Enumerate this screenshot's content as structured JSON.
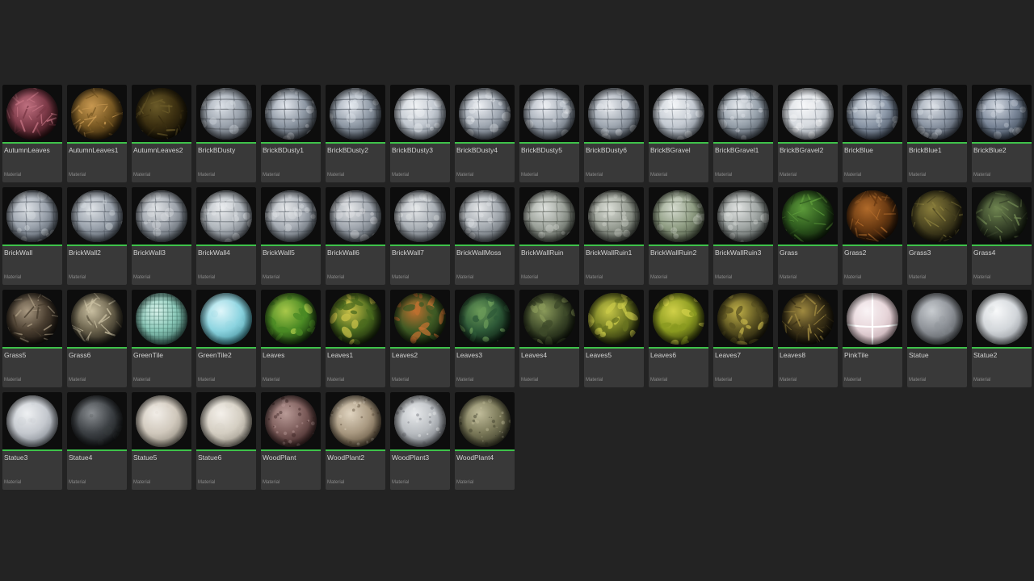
{
  "asset_type_label": "Material",
  "accent_color": "#3ec24a",
  "assets": [
    {
      "name": "AutumnLeaves",
      "base": "#2a0f12",
      "mid": "#7a3846",
      "hi": "#c07080",
      "pattern": "fibers"
    },
    {
      "name": "AutumnLeaves1",
      "base": "#2b1e08",
      "mid": "#7a5a24",
      "hi": "#c89850",
      "pattern": "fibers"
    },
    {
      "name": "AutumnLeaves2",
      "base": "#120e04",
      "mid": "#3a2e10",
      "hi": "#6a5a28",
      "pattern": "fibers"
    },
    {
      "name": "BrickBDusty",
      "base": "#4a5058",
      "mid": "#9aa2ac",
      "hi": "#dde2e8",
      "pattern": "bricks"
    },
    {
      "name": "BrickBDusty1",
      "base": "#3a4048",
      "mid": "#8c96a2",
      "hi": "#e4e8ee",
      "pattern": "bricks"
    },
    {
      "name": "BrickBDusty2",
      "base": "#3e4650",
      "mid": "#909aa6",
      "hi": "#e6eaf0",
      "pattern": "bricks"
    },
    {
      "name": "BrickBDusty3",
      "base": "#6a727c",
      "mid": "#c2c8d0",
      "hi": "#f2f4f6",
      "pattern": "bricks"
    },
    {
      "name": "BrickBDusty4",
      "base": "#4a525c",
      "mid": "#a0a8b2",
      "hi": "#eef0f4",
      "pattern": "bricks"
    },
    {
      "name": "BrickBDusty5",
      "base": "#4a525c",
      "mid": "#a4acb6",
      "hi": "#eef0f4",
      "pattern": "bricks"
    },
    {
      "name": "BrickBDusty6",
      "base": "#48505a",
      "mid": "#a0a8b2",
      "hi": "#eceef2",
      "pattern": "bricks"
    },
    {
      "name": "BrickBGravel",
      "base": "#6c747e",
      "mid": "#c4cad2",
      "hi": "#f4f6f8",
      "pattern": "bricks"
    },
    {
      "name": "BrickBGravel1",
      "base": "#424a54",
      "mid": "#96a0aa",
      "hi": "#e8ecf0",
      "pattern": "bricks"
    },
    {
      "name": "BrickBGravel2",
      "base": "#80868e",
      "mid": "#d6dadf",
      "hi": "#f8f9fa",
      "pattern": "bricks"
    },
    {
      "name": "BrickBlue",
      "base": "#3a4452",
      "mid": "#8a96a6",
      "hi": "#dfe4ea",
      "pattern": "bricks"
    },
    {
      "name": "BrickBlue1",
      "base": "#3c4450",
      "mid": "#8c96a4",
      "hi": "#e0e4ea",
      "pattern": "bricks"
    },
    {
      "name": "BrickBlue2",
      "base": "#34404e",
      "mid": "#7a8698",
      "hi": "#d4dae2",
      "pattern": "bricks"
    },
    {
      "name": "BrickWall",
      "base": "#48505a",
      "mid": "#98a0aa",
      "hi": "#dde1e6",
      "pattern": "bricks"
    },
    {
      "name": "BrickWall2",
      "base": "#4a525c",
      "mid": "#9aa2ac",
      "hi": "#e0e4e8",
      "pattern": "bricks"
    },
    {
      "name": "BrickWall3",
      "base": "#4c545c",
      "mid": "#9ca2aa",
      "hi": "#e0e3e6",
      "pattern": "bricks"
    },
    {
      "name": "BrickWall4",
      "base": "#5a6068",
      "mid": "#b0b6bc",
      "hi": "#eceef0",
      "pattern": "bricks"
    },
    {
      "name": "BrickWall5",
      "base": "#505860",
      "mid": "#a4aab2",
      "hi": "#e6e8ea",
      "pattern": "bricks"
    },
    {
      "name": "BrickWall6",
      "base": "#4e565e",
      "mid": "#a0a6ae",
      "hi": "#e4e6e8",
      "pattern": "bricks"
    },
    {
      "name": "BrickWall7",
      "base": "#545a62",
      "mid": "#a8aeb4",
      "hi": "#e8eaec",
      "pattern": "bricks"
    },
    {
      "name": "BrickWallMoss",
      "base": "#50565c",
      "mid": "#a2a8ae",
      "hi": "#e6e8ea",
      "pattern": "bricks"
    },
    {
      "name": "BrickWallRuin",
      "base": "#4a5048",
      "mid": "#9aa098",
      "hi": "#dfe2de",
      "pattern": "bricks"
    },
    {
      "name": "BrickWallRuin1",
      "base": "#484e46",
      "mid": "#969c92",
      "hi": "#dcdfd8",
      "pattern": "bricks"
    },
    {
      "name": "BrickWallRuin2",
      "base": "#46503e",
      "mid": "#8e9c82",
      "hi": "#d6dcd0",
      "pattern": "bricks"
    },
    {
      "name": "BrickWallRuin3",
      "base": "#4c5250",
      "mid": "#9ea4a2",
      "hi": "#e2e4e3",
      "pattern": "bricks"
    },
    {
      "name": "Grass",
      "base": "#0c1a08",
      "mid": "#2e5a1e",
      "hi": "#5c9a3a",
      "pattern": "fibers"
    },
    {
      "name": "Grass2",
      "base": "#1c0e04",
      "mid": "#6a3a12",
      "hi": "#b06a2a",
      "pattern": "fibers"
    },
    {
      "name": "Grass3",
      "base": "#141208",
      "mid": "#4a4420",
      "hi": "#8a7e3c",
      "pattern": "fibers"
    },
    {
      "name": "Grass4",
      "base": "#0e140a",
      "mid": "#38442a",
      "hi": "#6e8450",
      "pattern": "fibers"
    },
    {
      "name": "Grass5",
      "base": "#120e0a",
      "mid": "#4a3e30",
      "hi": "#a89880",
      "pattern": "fibers"
    },
    {
      "name": "Grass6",
      "base": "#1c1a14",
      "mid": "#6a624c",
      "hi": "#c8bea0",
      "pattern": "fibers"
    },
    {
      "name": "GreenTile",
      "base": "#3c6a60",
      "mid": "#8ac8b8",
      "hi": "#d8f2ea",
      "pattern": "tiles"
    },
    {
      "name": "GreenTile2",
      "base": "#3e8a96",
      "mid": "#8cd4e0",
      "hi": "#dff6fa",
      "pattern": "smooth"
    },
    {
      "name": "Leaves",
      "base": "#14300c",
      "mid": "#4a8a24",
      "hi": "#a8c84a",
      "pattern": "leaves"
    },
    {
      "name": "Leaves1",
      "base": "#121e08",
      "mid": "#4a6a1e",
      "hi": "#c8c048",
      "pattern": "leaves"
    },
    {
      "name": "Leaves2",
      "base": "#121e0a",
      "mid": "#3e5a24",
      "hi": "#c07030",
      "pattern": "leaves"
    },
    {
      "name": "Leaves3",
      "base": "#0a1a10",
      "mid": "#2e5a38",
      "hi": "#6a9a58",
      "pattern": "leaves"
    },
    {
      "name": "Leaves4",
      "base": "#0e140a",
      "mid": "#3e4a2a",
      "hi": "#8a9a5a",
      "pattern": "leaves"
    },
    {
      "name": "Leaves5",
      "base": "#1a1e08",
      "mid": "#6a7420",
      "hi": "#c8c848",
      "pattern": "leaves"
    },
    {
      "name": "Leaves6",
      "base": "#2a3008",
      "mid": "#8a9a20",
      "hi": "#d0d048",
      "pattern": "leaves"
    },
    {
      "name": "Leaves7",
      "base": "#161408",
      "mid": "#5a5220",
      "hi": "#c0b048",
      "pattern": "leaves"
    },
    {
      "name": "Leaves8",
      "base": "#0e0c06",
      "mid": "#3e3418",
      "hi": "#a08a40",
      "pattern": "fibers"
    },
    {
      "name": "PinkTile",
      "base": "#b8a0a6",
      "mid": "#e6d4d8",
      "hi": "#faf4f6",
      "pattern": "pink"
    },
    {
      "name": "Statue",
      "base": "#505458",
      "mid": "#8c9096",
      "hi": "#c8ccd0",
      "pattern": "smooth"
    },
    {
      "name": "Statue2",
      "base": "#8a8e94",
      "mid": "#d2d6da",
      "hi": "#f8f9fa",
      "pattern": "smooth"
    },
    {
      "name": "Statue3",
      "base": "#7a8088",
      "mid": "#c4c8ce",
      "hi": "#eef0f2",
      "pattern": "smooth"
    },
    {
      "name": "Statue4",
      "base": "#121416",
      "mid": "#3c4044",
      "hi": "#8a8e92",
      "pattern": "smooth"
    },
    {
      "name": "Statue5",
      "base": "#8a8478",
      "mid": "#d0c8bc",
      "hi": "#f2eee8",
      "pattern": "smooth"
    },
    {
      "name": "Statue6",
      "base": "#948e82",
      "mid": "#d4cec2",
      "hi": "#f4f0ea",
      "pattern": "smooth"
    },
    {
      "name": "WoodPlant",
      "base": "#3a2222",
      "mid": "#7a5a58",
      "hi": "#b89a96",
      "pattern": "rough"
    },
    {
      "name": "WoodPlant2",
      "base": "#5a4c38",
      "mid": "#a89880",
      "hi": "#e0d4c0",
      "pattern": "rough"
    },
    {
      "name": "WoodPlant3",
      "base": "#70747a",
      "mid": "#b8bcc0",
      "hi": "#e8eaec",
      "pattern": "rough"
    },
    {
      "name": "WoodPlant4",
      "base": "#3a3a28",
      "mid": "#7a7858",
      "hi": "#c0bc9a",
      "pattern": "rough"
    }
  ]
}
